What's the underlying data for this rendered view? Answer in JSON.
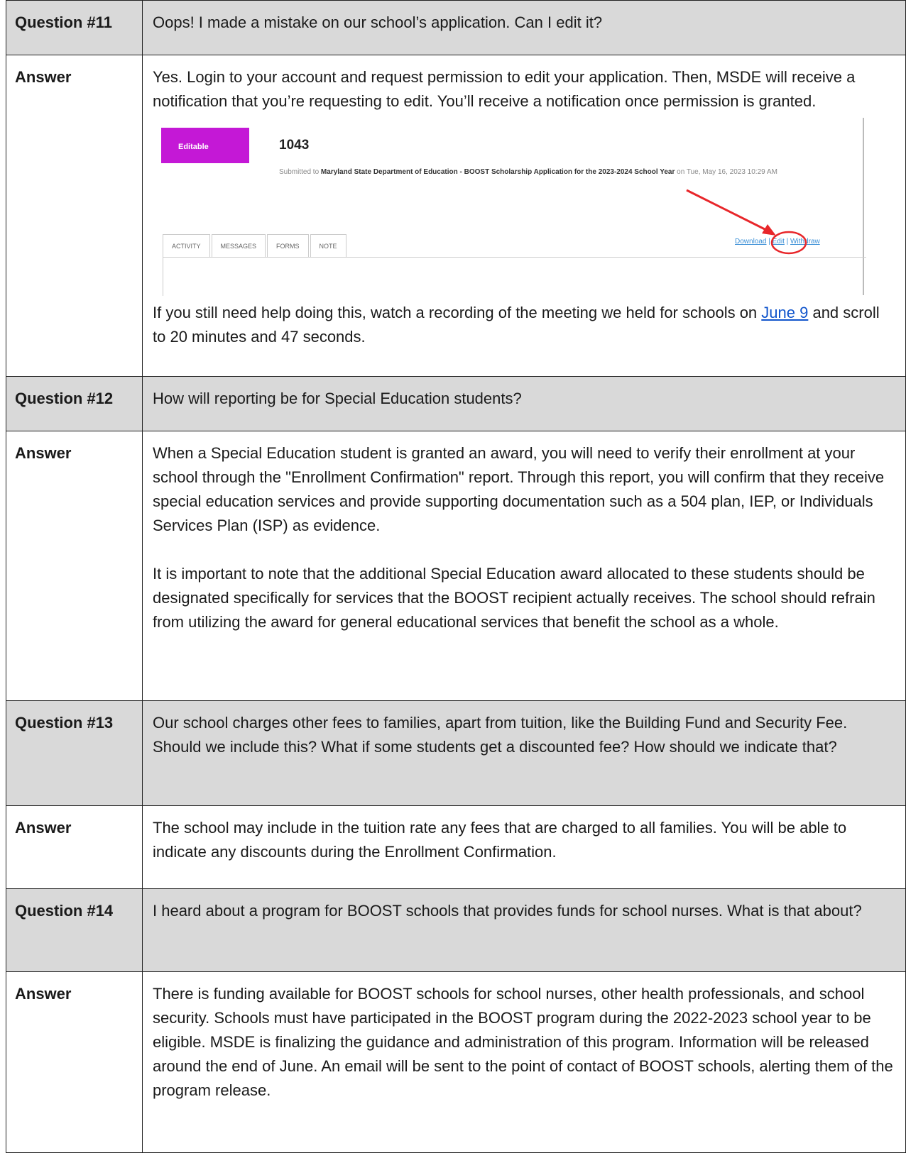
{
  "rows": [
    {
      "question_label": "Question #11",
      "question": "Oops! I made a mistake on our school’s application. Can I edit it?",
      "answer_label": "Answer",
      "answer_intro": "Yes. Login to your account and request permission to edit your application. Then, MSDE will receive a notification that you’re requesting to edit. You’ll receive a notification once permission is granted.",
      "screenshot": {
        "badge": "Editable",
        "id": "1043",
        "submitted_prefix": "Submitted to ",
        "submitted_org": "Maryland State Department of Education - BOOST Scholarship Application for the 2023-2024 School Year",
        "submitted_suffix": " on Tue, May 16, 2023 10:29 AM",
        "tabs": [
          "ACTIVITY",
          "MESSAGES",
          "FORMS",
          "NOTE"
        ],
        "actions": {
          "download": "Download",
          "sep1": " | ",
          "edit": "Edit",
          "sep2": " | ",
          "withdraw": "Withdraw"
        },
        "annotation_color": "#e8262a"
      },
      "answer_outro_before": "If you still need help doing this, watch a recording of the meeting we held for schools on ",
      "answer_outro_link": "June 9",
      "answer_outro_after": " and scroll to 20 minutes and 47 seconds."
    },
    {
      "question_label": "Question #12",
      "question": "How will reporting be for Special Education students?",
      "answer_label": "Answer",
      "answer_p1": "When a Special Education student is granted an award, you will need to verify their enrollment at your school through the \"Enrollment Confirmation\" report. Through this report, you will confirm that they receive special education services and provide supporting documentation such as a 504 plan, IEP, or Individuals Services Plan (ISP) as evidence.",
      "answer_p2": "It is important to note that the additional Special Education award allocated to these students should be designated specifically for services that the BOOST recipient actually receives. The school should refrain from utilizing the award for general educational services that benefit the school as a whole."
    },
    {
      "question_label": "Question #13",
      "question": "Our school charges other fees to families, apart from tuition, like the Building Fund and Security Fee. Should we include this? What if some students get a discounted fee? How should we indicate that?",
      "answer_label": "Answer",
      "answer": "The school may include in the tuition rate any fees that are charged to all families. You will be able to indicate any discounts during the Enrollment Confirmation."
    },
    {
      "question_label": "Question #14",
      "question": "I heard about a program for BOOST schools that provides funds for school nurses. What is that about?",
      "answer_label": "Answer",
      "answer": "There is funding available for BOOST schools for school nurses, other health professionals, and school security. Schools must have participated in the BOOST program during the 2022-2023 school year to be eligible. MSDE is finalizing the guidance and administration of this program. Information will be released around the end of June. An email will be sent to the point of contact of BOOST schools, alerting them of the program release."
    }
  ]
}
